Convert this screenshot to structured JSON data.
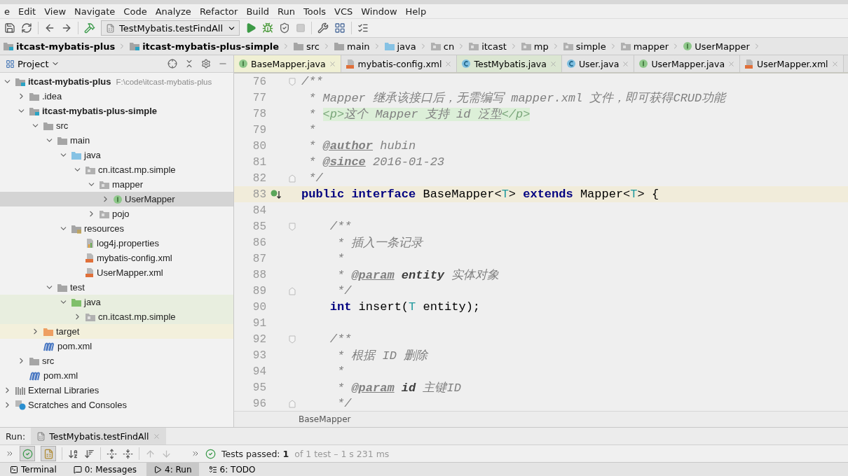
{
  "menu": [
    "e",
    "Edit",
    "View",
    "Navigate",
    "Code",
    "Analyze",
    "Refactor",
    "Build",
    "Run",
    "Tools",
    "VCS",
    "Window",
    "Help"
  ],
  "toolbar": {
    "run_config": "TestMybatis.testFindAll"
  },
  "navbar": [
    {
      "label": "itcast-mybatis-plus",
      "kind": "module",
      "bold": true
    },
    {
      "label": "itcast-mybatis-plus-simple",
      "kind": "module",
      "bold": true
    },
    {
      "label": "src",
      "kind": "folder",
      "bold": false
    },
    {
      "label": "main",
      "kind": "folder",
      "bold": false
    },
    {
      "label": "java",
      "kind": "source",
      "bold": false
    },
    {
      "label": "cn",
      "kind": "package",
      "bold": false
    },
    {
      "label": "itcast",
      "kind": "package",
      "bold": false
    },
    {
      "label": "mp",
      "kind": "package",
      "bold": false
    },
    {
      "label": "simple",
      "kind": "package",
      "bold": false
    },
    {
      "label": "mapper",
      "kind": "package",
      "bold": false
    },
    {
      "label": "UserMapper",
      "kind": "interface",
      "bold": false
    }
  ],
  "project": {
    "title": "Project",
    "tree": [
      {
        "name": "itcast-mybatis-plus",
        "kind": "module",
        "bold": true,
        "path": "F:\\code\\itcast-mybatis-plus",
        "expanded": true,
        "selected": false,
        "children": [
          {
            "name": ".idea",
            "kind": "folder",
            "bold": false,
            "expanded": false,
            "selected": false
          },
          {
            "name": "itcast-mybatis-plus-simple",
            "kind": "module",
            "bold": true,
            "expanded": true,
            "selected": false,
            "children": [
              {
                "name": "src",
                "kind": "folder",
                "bold": false,
                "expanded": true,
                "selected": false,
                "children": [
                  {
                    "name": "main",
                    "kind": "folder",
                    "bold": false,
                    "expanded": true,
                    "selected": false,
                    "children": [
                      {
                        "name": "java",
                        "kind": "source",
                        "bold": false,
                        "expanded": true,
                        "selected": false,
                        "children": [
                          {
                            "name": "cn.itcast.mp.simple",
                            "kind": "package",
                            "bold": false,
                            "expanded": true,
                            "selected": false,
                            "children": [
                              {
                                "name": "mapper",
                                "kind": "package",
                                "bold": false,
                                "expanded": true,
                                "selected": false,
                                "children": [
                                  {
                                    "name": "UserMapper",
                                    "kind": "interface",
                                    "bold": false,
                                    "expanded": false,
                                    "selected": true
                                  }
                                ]
                              },
                              {
                                "name": "pojo",
                                "kind": "package",
                                "bold": false,
                                "expanded": false,
                                "selected": false
                              }
                            ]
                          }
                        ]
                      },
                      {
                        "name": "resources",
                        "kind": "resources",
                        "bold": false,
                        "expanded": true,
                        "selected": false,
                        "children": [
                          {
                            "name": "log4j.properties",
                            "kind": "properties",
                            "bold": false,
                            "selected": false
                          },
                          {
                            "name": "mybatis-config.xml",
                            "kind": "xml",
                            "bold": false,
                            "selected": false
                          },
                          {
                            "name": "UserMapper.xml",
                            "kind": "xml",
                            "bold": false,
                            "selected": false
                          }
                        ]
                      }
                    ]
                  },
                  {
                    "name": "test",
                    "kind": "folder",
                    "bold": false,
                    "expanded": true,
                    "selected": false,
                    "children": [
                      {
                        "name": "java",
                        "kind": "test-source",
                        "bold": false,
                        "expanded": true,
                        "selected": false,
                        "children": [
                          {
                            "name": "cn.itcast.mp.simple",
                            "kind": "test-package",
                            "bold": false,
                            "expanded": false,
                            "selected": false
                          }
                        ]
                      }
                    ]
                  }
                ]
              },
              {
                "name": "target",
                "kind": "excluded",
                "bold": false,
                "expanded": false,
                "selected": false
              },
              {
                "name": "pom.xml",
                "kind": "maven",
                "bold": false,
                "selected": false
              }
            ]
          },
          {
            "name": "src",
            "kind": "folder",
            "bold": false,
            "expanded": false,
            "selected": false
          },
          {
            "name": "pom.xml",
            "kind": "maven",
            "bold": false,
            "selected": false
          }
        ]
      },
      {
        "name": "External Libraries",
        "kind": "libraries",
        "bold": false,
        "expanded": false,
        "selected": false
      },
      {
        "name": "Scratches and Consoles",
        "kind": "scratches",
        "bold": false,
        "expanded": false,
        "selected": false
      }
    ]
  },
  "editor": {
    "tabs": [
      {
        "label": "BaseMapper.java",
        "kind": "interface",
        "selected": true
      },
      {
        "label": "mybatis-config.xml",
        "kind": "xml",
        "selected": false
      },
      {
        "label": "TestMybatis.java",
        "kind": "test-class",
        "selected": false
      },
      {
        "label": "User.java",
        "kind": "class",
        "selected": false
      },
      {
        "label": "UserMapper.java",
        "kind": "interface",
        "selected": false
      },
      {
        "label": "UserMapper.xml",
        "kind": "xml",
        "selected": false
      }
    ],
    "lines": [
      {
        "number": "76",
        "kind": "fold-start",
        "current": false,
        "marker": false,
        "tokens": [
          {
            "kind": "comment",
            "text": "/**"
          }
        ]
      },
      {
        "number": "77",
        "kind": "plain",
        "current": false,
        "marker": false,
        "tokens": [
          {
            "kind": "comment",
            "text": " * Mapper 继承该接口后，无需编写 mapper.xml 文件，即可获得CRUD功能"
          }
        ]
      },
      {
        "number": "78",
        "kind": "plain",
        "current": false,
        "marker": false,
        "tokens": [
          {
            "kind": "comment",
            "text": " * "
          },
          {
            "kind": "html",
            "text": "<p>"
          },
          {
            "kind": "htmltext",
            "text": "这个 Mapper 支持 id 泛型"
          },
          {
            "kind": "html",
            "text": "</p>"
          }
        ]
      },
      {
        "number": "79",
        "kind": "plain",
        "current": false,
        "marker": false,
        "tokens": [
          {
            "kind": "comment",
            "text": " *"
          }
        ]
      },
      {
        "number": "80",
        "kind": "plain",
        "current": false,
        "marker": false,
        "tokens": [
          {
            "kind": "comment",
            "text": " * "
          },
          {
            "kind": "doctag",
            "text": "@author"
          },
          {
            "kind": "comment",
            "text": " hubin"
          }
        ]
      },
      {
        "number": "81",
        "kind": "plain",
        "current": false,
        "marker": false,
        "tokens": [
          {
            "kind": "comment",
            "text": " * "
          },
          {
            "kind": "doctag",
            "text": "@since"
          },
          {
            "kind": "comment",
            "text": " 2016-01-23"
          }
        ]
      },
      {
        "number": "82",
        "kind": "fold-end",
        "current": false,
        "marker": false,
        "tokens": [
          {
            "kind": "comment",
            "text": " */"
          }
        ]
      },
      {
        "number": "83",
        "kind": "plain",
        "current": true,
        "marker": true,
        "tokens": [
          {
            "kind": "keyword",
            "text": "public interface"
          },
          {
            "kind": "plain",
            "text": " BaseMapper<"
          },
          {
            "kind": "typeparam",
            "text": "T"
          },
          {
            "kind": "plain",
            "text": "> "
          },
          {
            "kind": "keyword",
            "text": "extends"
          },
          {
            "kind": "plain",
            "text": " Mapper<"
          },
          {
            "kind": "typeparam",
            "text": "T"
          },
          {
            "kind": "plain",
            "text": "> {"
          }
        ]
      },
      {
        "number": "84",
        "kind": "plain",
        "current": false,
        "marker": false
      },
      {
        "number": "85",
        "kind": "fold-start",
        "current": false,
        "marker": false,
        "tokens": [
          {
            "kind": "comment",
            "text": "    /**"
          }
        ]
      },
      {
        "number": "86",
        "kind": "plain",
        "current": false,
        "marker": false,
        "tokens": [
          {
            "kind": "comment",
            "text": "     * 插入一条记录"
          }
        ]
      },
      {
        "number": "87",
        "kind": "plain",
        "current": false,
        "marker": false,
        "tokens": [
          {
            "kind": "comment",
            "text": "     *"
          }
        ]
      },
      {
        "number": "88",
        "kind": "plain",
        "current": false,
        "marker": false,
        "tokens": [
          {
            "kind": "comment",
            "text": "     * "
          },
          {
            "kind": "doctag",
            "text": "@param"
          },
          {
            "kind": "docparam",
            "text": " entity"
          },
          {
            "kind": "comment",
            "text": " 实体对象"
          }
        ]
      },
      {
        "number": "89",
        "kind": "fold-end",
        "current": false,
        "marker": false,
        "tokens": [
          {
            "kind": "comment",
            "text": "     */"
          }
        ]
      },
      {
        "number": "90",
        "kind": "plain",
        "current": false,
        "marker": false,
        "tokens": [
          {
            "kind": "keyword",
            "text": "    int"
          },
          {
            "kind": "plain",
            "text": " insert("
          },
          {
            "kind": "typeparam",
            "text": "T"
          },
          {
            "kind": "plain",
            "text": " entity);"
          }
        ]
      },
      {
        "number": "91",
        "kind": "plain",
        "current": false,
        "marker": false
      },
      {
        "number": "92",
        "kind": "fold-start",
        "current": false,
        "marker": false,
        "tokens": [
          {
            "kind": "comment",
            "text": "    /**"
          }
        ]
      },
      {
        "number": "93",
        "kind": "plain",
        "current": false,
        "marker": false,
        "tokens": [
          {
            "kind": "comment",
            "text": "     * 根据 ID 删除"
          }
        ]
      },
      {
        "number": "94",
        "kind": "plain",
        "current": false,
        "marker": false,
        "tokens": [
          {
            "kind": "comment",
            "text": "     *"
          }
        ]
      },
      {
        "number": "95",
        "kind": "plain",
        "current": false,
        "marker": false,
        "tokens": [
          {
            "kind": "comment",
            "text": "     * "
          },
          {
            "kind": "doctag",
            "text": "@param"
          },
          {
            "kind": "docparam",
            "text": " id"
          },
          {
            "kind": "comment",
            "text": " 主键ID"
          }
        ]
      },
      {
        "number": "96",
        "kind": "fold-end",
        "current": false,
        "marker": false,
        "tokens": [
          {
            "kind": "comment",
            "text": "     */"
          }
        ]
      }
    ],
    "breadcrumb": "BaseMapper"
  },
  "run": {
    "label": "Run:",
    "tab": "TestMybatis.testFindAll",
    "show_passed": true,
    "show_ignored": true,
    "status": "Tests passed: **1**",
    "detail": "of 1 test – 1 s 231 ms"
  },
  "bottom_tabs": [
    {
      "label": "Terminal",
      "kind": "terminal",
      "selected": false
    },
    {
      "label": "0: Messages",
      "kind": "messages",
      "selected": false
    },
    {
      "label": "4: Run",
      "kind": "run",
      "selected": true
    },
    {
      "label": "6: TODO",
      "kind": "todo",
      "selected": false
    }
  ]
}
